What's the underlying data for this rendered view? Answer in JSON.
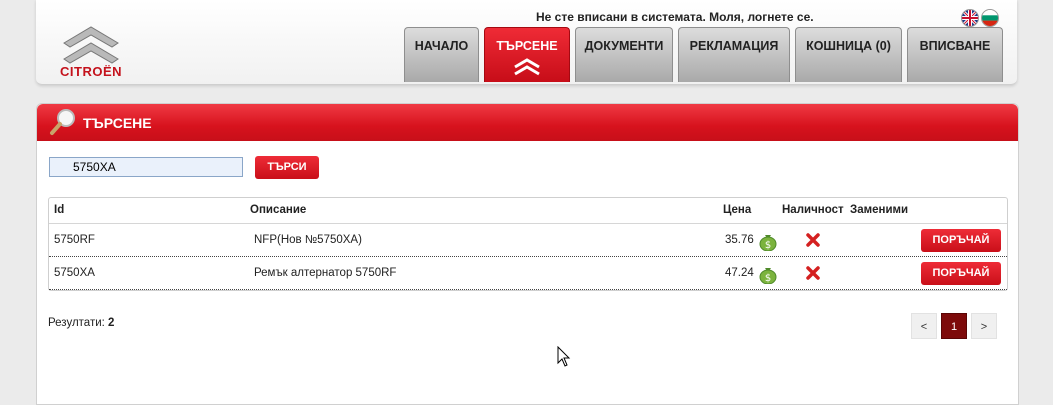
{
  "header": {
    "brand": "CITROËN",
    "login_message": "Не сте вписани в системата. Моля, логнете се.",
    "tabs": [
      {
        "label": "НАЧАЛО"
      },
      {
        "label": "ТЪРСЕНЕ"
      },
      {
        "label": "ДОКУМЕНТИ"
      },
      {
        "label": "РЕКЛАМАЦИЯ"
      },
      {
        "label": "КОШНИЦА (0)"
      },
      {
        "label": "ВПИСВАНЕ"
      }
    ],
    "active_tab": "ТЪРСЕНЕ",
    "languages": [
      "uk-flag-icon",
      "bg-flag-icon"
    ]
  },
  "search": {
    "title": "ТЪРСЕНЕ",
    "query": "5750XA",
    "button": "ТЪРСИ"
  },
  "table": {
    "headers": {
      "id": "Id",
      "description": "Описание",
      "price": "Цена",
      "availability": "Наличност",
      "replacements": "Заменими"
    },
    "rows": [
      {
        "id": "5750RF",
        "description": "NFP(Нов №5750XA)",
        "price": "35.76",
        "order": "ПОРЪЧАЙ"
      },
      {
        "id": "5750XA",
        "description": "Ремък алтернатор 5750RF",
        "price": "47.24",
        "order": "ПОРЪЧАЙ"
      }
    ]
  },
  "results": {
    "label": "Резултати:",
    "count": "2"
  },
  "pagination": {
    "prev": "<",
    "current": "1",
    "next": ">"
  },
  "colors": {
    "accent": "#d7121d",
    "page_active": "#7d0a0a"
  }
}
